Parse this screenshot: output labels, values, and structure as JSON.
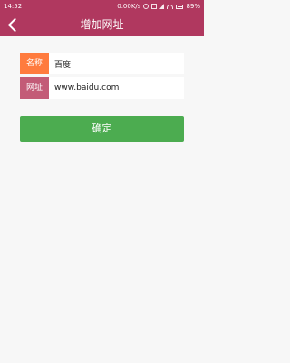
{
  "status": {
    "time": "14:52",
    "network": "0.00K/s",
    "battery": "89%"
  },
  "header": {
    "title": "增加网址",
    "back_icon": "chevron-left-icon"
  },
  "form": {
    "name_label": "名称",
    "name_value": "百度",
    "url_label": "网址",
    "url_value": "www.baidu.com"
  },
  "actions": {
    "confirm_label": "确定"
  },
  "colors": {
    "header": "#b0385f",
    "name_label_bg": "#ff7b3e",
    "url_label_bg": "#c35b77",
    "confirm_button": "#4cac50",
    "background": "#f7f7f7"
  }
}
